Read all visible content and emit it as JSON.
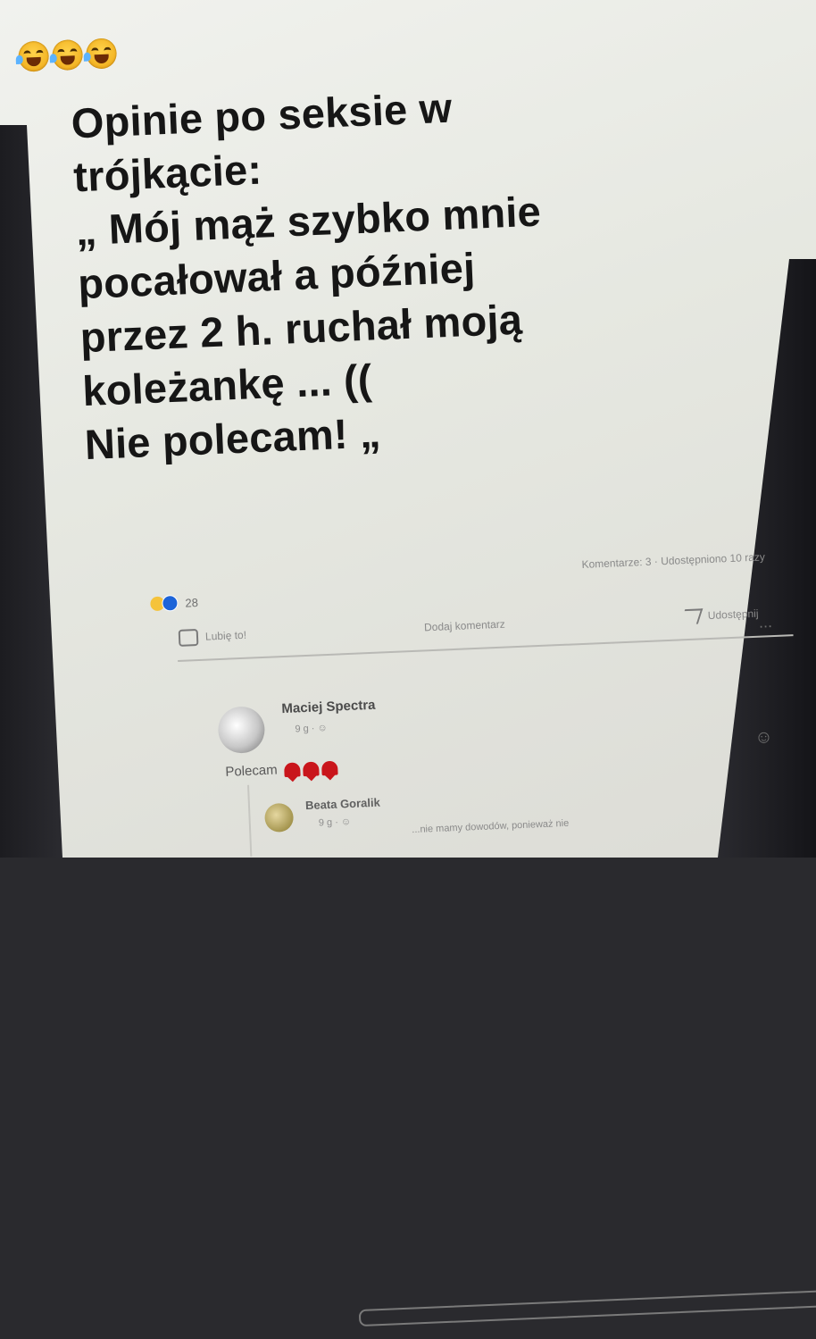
{
  "post": {
    "emojis": [
      "crying-laughing-emoji",
      "crying-laughing-emoji",
      "crying-laughing-emoji"
    ],
    "text_lines": [
      "Opinie po seksie w",
      "trójkącie:",
      "„ Mój mąż szybko mnie",
      "pocałował a później",
      "przez 2 h. ruchał moją",
      "koleżankę ... ((",
      "Nie polecam! „"
    ]
  },
  "stats": {
    "reaction_count": "28",
    "share_stats": "Komentarze: 3 · Udostępniono 10 razy"
  },
  "actions": {
    "like_label": "Lubię to!",
    "comment_label": "Dodaj komentarz",
    "share_label": "Udostępnij",
    "more_label": "..."
  },
  "comment": {
    "name": "Maciej Spectra",
    "meta": "9 g · ☺",
    "text": "Polecam"
  },
  "reply": {
    "name": "Beata Goralik",
    "meta": "9 g · ☺",
    "text": "...nie mamy dowodów, ponieważ nie"
  },
  "colors": {
    "heart": "#c9151b",
    "like_blue": "#1c64d8",
    "text": "#161616"
  }
}
